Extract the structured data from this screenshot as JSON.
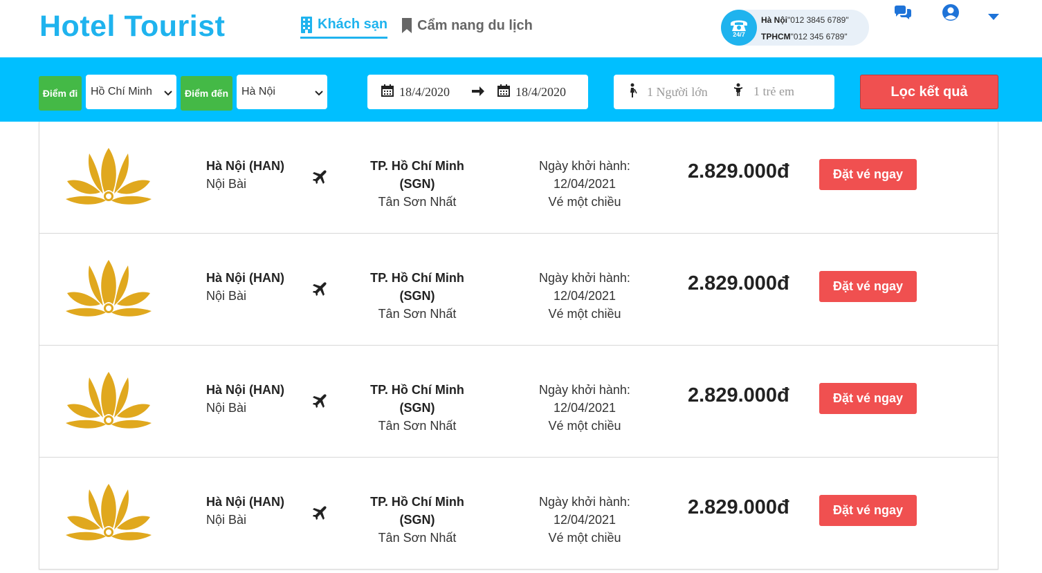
{
  "brand": {
    "name": "Hotel Tourist"
  },
  "nav": [
    {
      "label": "Khách sạn",
      "icon": "building-icon",
      "active": true
    },
    {
      "label": "Cẩm nang du lịch",
      "icon": "bookmark-icon",
      "active": false
    }
  ],
  "hotline": {
    "icon_label": "24/7",
    "hn_city": "Hà Nội",
    "hn_phone": "\"012 3845 6789\"",
    "hcm_city": "TPHCM",
    "hcm_phone": "\"012 345 6789\""
  },
  "search": {
    "from_label": "Điểm đi",
    "from_value": "Hồ Chí Minh",
    "to_label": "Điểm đến",
    "to_value": "Hà Nội",
    "date_start": "18/4/2020",
    "date_end": "18/4/2020",
    "adults": "1 Người lớn",
    "children": "1 trẻ em",
    "filter_label": "Lọc kết quả"
  },
  "results": [
    {
      "from_city": "Hà Nội (HAN)",
      "from_airport": "Nội Bài",
      "to_city": "TP. Hồ Chí Minh (SGN)",
      "to_airport": "Tân Sơn Nhất",
      "date": "Ngày khởi hành: 12/04/2021",
      "trip_type": "Vé một chiều",
      "price": "2.829.000đ",
      "button": "Đặt vé ngay"
    },
    {
      "from_city": "Hà Nội (HAN)",
      "from_airport": "Nội Bài",
      "to_city": "TP. Hồ Chí Minh (SGN)",
      "to_airport": "Tân Sơn Nhất",
      "date": "Ngày khởi hành: 12/04/2021",
      "trip_type": "Vé một chiều",
      "price": "2.829.000đ",
      "button": "Đặt vé ngay"
    },
    {
      "from_city": "Hà Nội (HAN)",
      "from_airport": "Nội Bài",
      "to_city": "TP. Hồ Chí Minh (SGN)",
      "to_airport": "Tân Sơn Nhất",
      "date": "Ngày khởi hành: 12/04/2021",
      "trip_type": "Vé một chiều",
      "price": "2.829.000đ",
      "button": "Đặt vé ngay"
    },
    {
      "from_city": "Hà Nội (HAN)",
      "from_airport": "Nội Bài",
      "to_city": "TP. Hồ Chí Minh (SGN)",
      "to_airport": "Tân Sơn Nhất",
      "date": "Ngày khởi hành: 12/04/2021",
      "trip_type": "Vé một chiều",
      "price": "2.829.000đ",
      "button": "Đặt vé ngay"
    }
  ],
  "colors": {
    "brand": "#1fb3ee",
    "search_bar": "#00bfff",
    "tag_green": "#44b946",
    "button_red": "#f05050",
    "logo_gold": "#e0a81e"
  }
}
